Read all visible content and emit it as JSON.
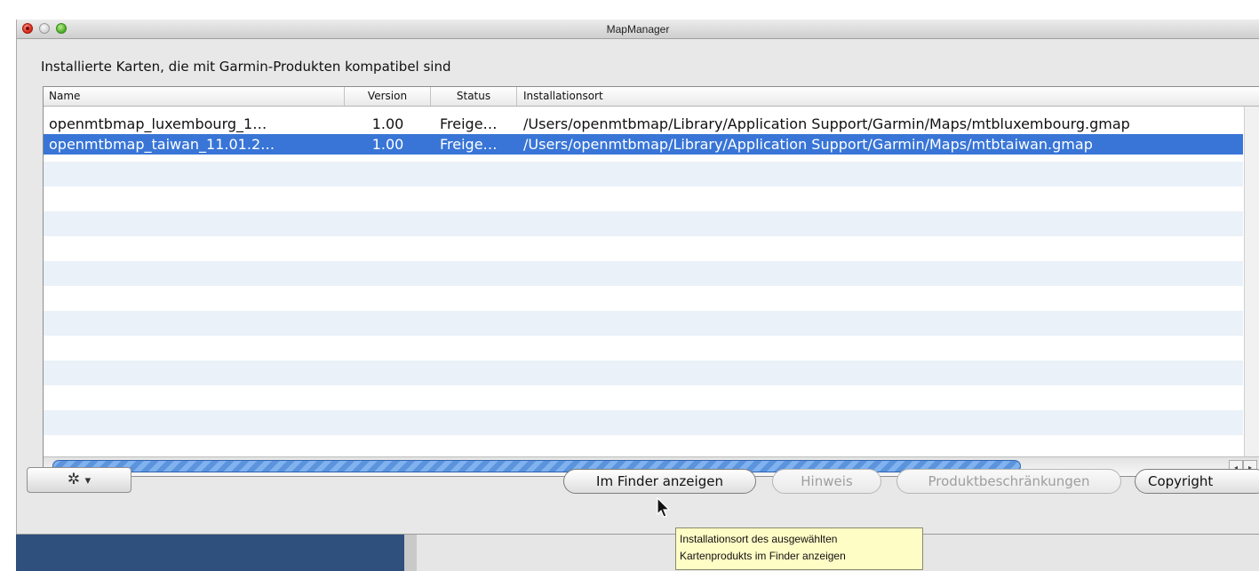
{
  "window": {
    "title": "MapManager"
  },
  "heading": "Installierte Karten, die mit Garmin-Produkten kompatibel sind",
  "table": {
    "columns": [
      "Name",
      "Version",
      "Status",
      "Installationsort"
    ],
    "rows": [
      {
        "name": "openmtbmap_luxembourg_1…",
        "version": "1.00",
        "status": "Freige…",
        "location": "/Users/openmtbmap/Library/Application Support/Garmin/Maps/mtbluxembourg.gmap",
        "selected": false
      },
      {
        "name": "openmtbmap_taiwan_11.01.2…",
        "version": "1.00",
        "status": "Freige…",
        "location": "/Users/openmtbmap/Library/Application Support/Garmin/Maps/mtbtaiwan.gmap",
        "selected": true
      }
    ]
  },
  "buttons": {
    "gear_icon": "gear-icon",
    "gear_glyph": "✲",
    "gear_arrow": "▾",
    "finder": "Im Finder anzeigen",
    "hinweis": "Hinweis",
    "produkt": "Produktbeschränkungen",
    "copyright": "Copyright"
  },
  "tooltip": {
    "line1": "Installationsort des ausgewählten",
    "line2": "Kartenprodukts im Finder anzeigen"
  },
  "scroll": {
    "left_arrow": "◂",
    "right_arrow": "▸"
  },
  "colors": {
    "selection": "#3875d7",
    "stripe": "#ebf1f8",
    "tooltip_bg": "#fffdc6"
  }
}
